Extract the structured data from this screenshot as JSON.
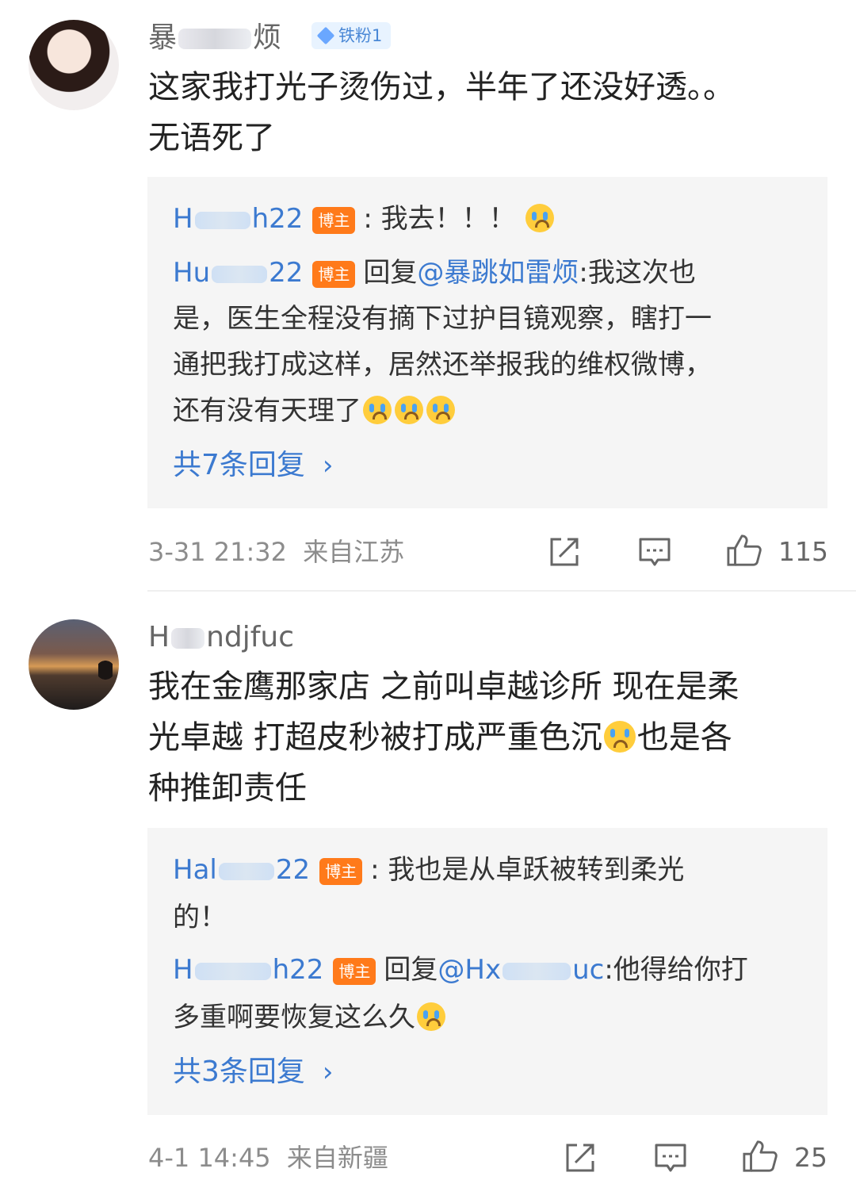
{
  "comments": [
    {
      "username": {
        "prefix": "暴",
        "suffix": "烦"
      },
      "fan_badge": "铁粉1",
      "text_lines": [
        "这家我打光子烫伤过，半年了还没好透。。",
        "无语死了"
      ],
      "replies": [
        {
          "name_start": "H",
          "name_end": "h22",
          "badge": "博主",
          "sep": ":",
          "text": "我去！！！"
        },
        {
          "name_start": "Hu",
          "name_end": "22",
          "badge": "博主",
          "reply_prefix": "回复",
          "mention": "@暴跳如雷烦",
          "sep": ":",
          "text_lines": [
            "我这次也",
            "是，医生全程没有摘下过护目镜观察，瞎打一",
            "通把我打成这样，居然还举报我的维权微博，",
            "还有没有天理了"
          ]
        }
      ],
      "more_replies": "共7条回复",
      "timestamp": "3-31 21:32",
      "location": "来自江苏",
      "like_count": "115"
    },
    {
      "username": {
        "prefix": "H",
        "suffix": "ndjfuc"
      },
      "text_lines": [
        "我在金鹰那家店 之前叫卓越诊所 现在是柔",
        "光卓越 打超皮秒被打成严重色沉",
        "也是各",
        "种推卸责任"
      ],
      "replies": [
        {
          "name_start": "Hal",
          "name_end": "22",
          "badge": "博主",
          "sep": ":",
          "text_lines": [
            "我也是从卓跃被转到柔光",
            "的！"
          ]
        },
        {
          "name_start": "H",
          "name_end": "h22",
          "badge": "博主",
          "reply_prefix": "回复",
          "mention_start": "@Hx",
          "mention_end": "uc",
          "sep": ":",
          "text_lines": [
            "他得给你打",
            "多重啊要恢复这么久"
          ]
        }
      ],
      "more_replies": "共3条回复",
      "timestamp": "4-1 14:45",
      "location": "来自新疆",
      "like_count": "25"
    }
  ],
  "colors": {
    "link": "#3c7ad0",
    "blogger_badge": "#ff7a1a",
    "fan_badge_bg": "#e8f3ff",
    "reply_bg": "#f5f5f5"
  },
  "icons": [
    "share-icon",
    "comment-icon",
    "like-icon",
    "crying-emoji",
    "chevron-right-icon",
    "diamond-icon"
  ]
}
